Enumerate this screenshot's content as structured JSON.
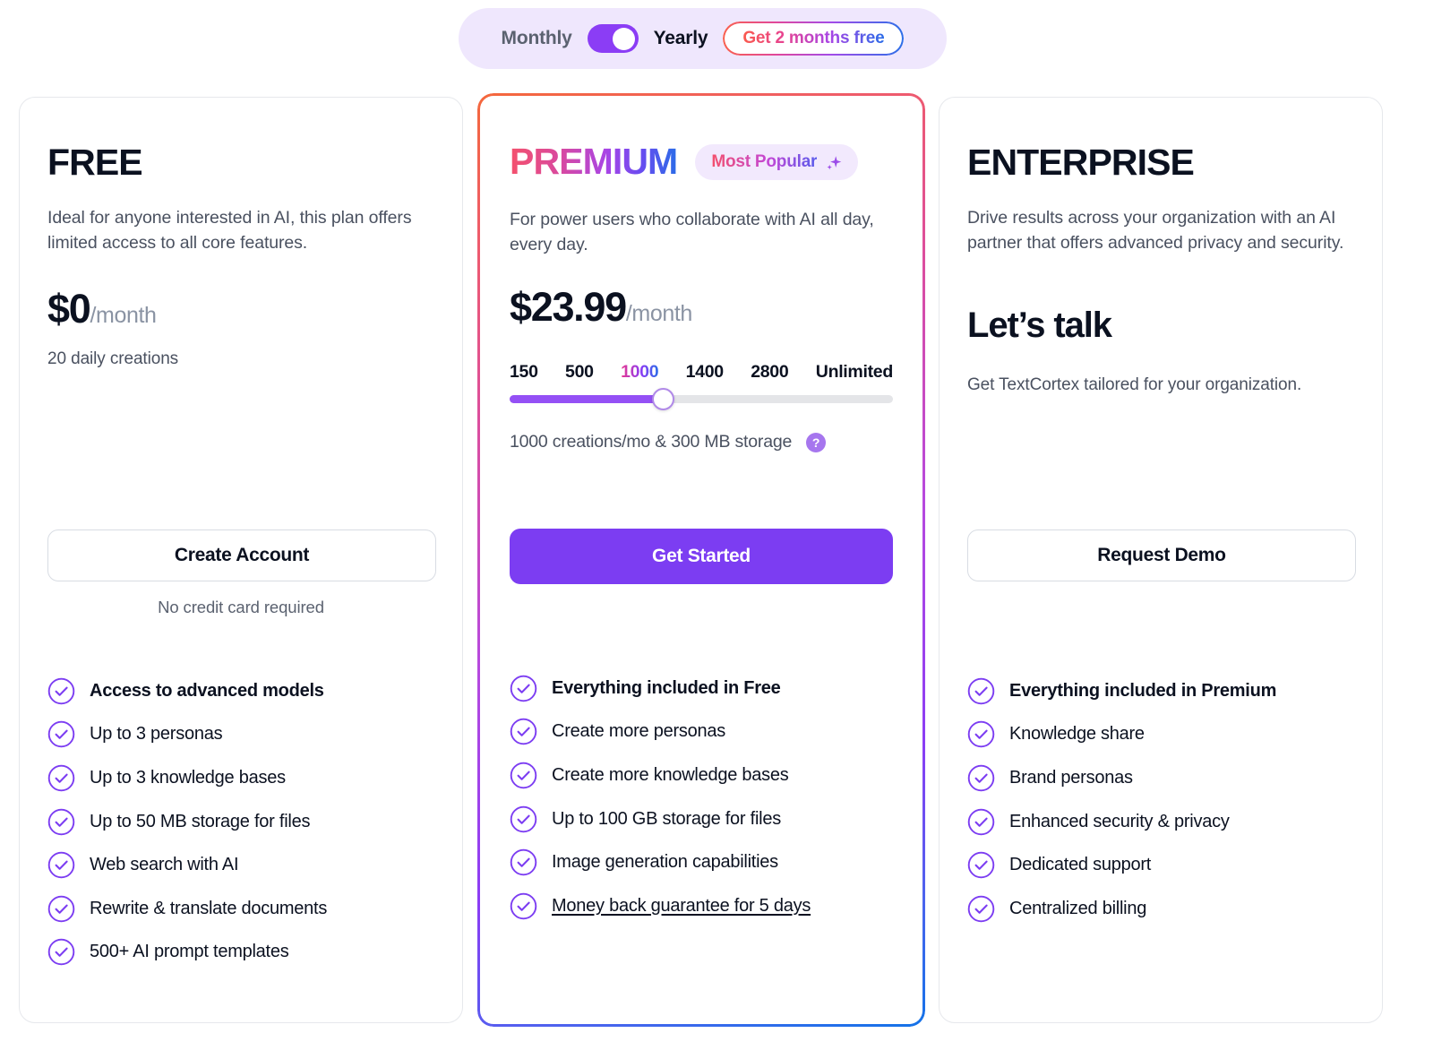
{
  "billing_toggle": {
    "monthly_label": "Monthly",
    "yearly_label": "Yearly",
    "promo_label": "Get 2 months free",
    "selected": "Monthly",
    "switch_state": "on"
  },
  "colors": {
    "accent_purple": "#7C3DF2",
    "toggle_purple": "#8B3DF5",
    "check_purple": "#7C3DF2",
    "badge_bg": "#F2E9FD",
    "toggle_bg": "#EFE7FD",
    "text_dark": "#0B1120",
    "text_muted": "#4A5160",
    "price_period": "#8A93A3",
    "card_border": "#E6E8EC",
    "slider_track": "#E4E5E8",
    "slider_fill": "#9450F5"
  },
  "plans": [
    {
      "name": "FREE",
      "badge": null,
      "description": "Ideal for anyone interested in AI, this plan offers limited access to all core features.",
      "price_amount": "$0",
      "price_period": "/month",
      "price_sub": "20 daily creations",
      "cta_label": "Create Account",
      "cta_style": "outline",
      "cta_note": "No credit card required",
      "features": [
        {
          "label": "Access to advanced models",
          "bold": true,
          "link": false
        },
        {
          "label": "Up to 3 personas",
          "bold": false,
          "link": false
        },
        {
          "label": "Up to 3 knowledge bases",
          "bold": false,
          "link": false
        },
        {
          "label": "Up to 50 MB storage for files",
          "bold": false,
          "link": false
        },
        {
          "label": "Web search with AI",
          "bold": false,
          "link": false
        },
        {
          "label": "Rewrite & translate documents",
          "bold": false,
          "link": false
        },
        {
          "label": "500+ AI prompt templates",
          "bold": false,
          "link": false
        }
      ]
    },
    {
      "name": "PREMIUM",
      "badge": "Most Popular",
      "badge_icon": "sparkles-icon",
      "description": "For power users who collaborate with AI all day, every day.",
      "price_amount": "$23.99",
      "price_period": "/month",
      "slider": {
        "ticks": [
          "150",
          "500",
          "1000",
          "1400",
          "2800",
          "Unlimited"
        ],
        "selected_value": "1000",
        "selected_index": 2,
        "fill_percent": 40,
        "caption": "1000 creations/mo & 300 MB storage",
        "help_icon": "question-mark-icon"
      },
      "cta_label": "Get Started",
      "cta_style": "solid",
      "features": [
        {
          "label": "Everything included in Free",
          "bold": true,
          "link": false
        },
        {
          "label": "Create more personas",
          "bold": false,
          "link": false
        },
        {
          "label": "Create more knowledge bases",
          "bold": false,
          "link": false
        },
        {
          "label": "Up to 100 GB storage for files",
          "bold": false,
          "link": false
        },
        {
          "label": "Image generation capabilities",
          "bold": false,
          "link": false
        },
        {
          "label": "Money back guarantee for 5 days",
          "bold": false,
          "link": true
        }
      ]
    },
    {
      "name": "ENTERPRISE",
      "badge": null,
      "description": "Drive results across your organization with an AI partner that offers advanced privacy and security.",
      "headline": "Let’s talk",
      "price_sub": "Get TextCortex tailored for your organization.",
      "cta_label": "Request Demo",
      "cta_style": "outline",
      "features": [
        {
          "label": "Everything included in Premium",
          "bold": true,
          "link": false
        },
        {
          "label": "Knowledge share",
          "bold": false,
          "link": false
        },
        {
          "label": "Brand personas",
          "bold": false,
          "link": false
        },
        {
          "label": "Enhanced security & privacy",
          "bold": false,
          "link": false
        },
        {
          "label": "Dedicated support",
          "bold": false,
          "link": false
        },
        {
          "label": "Centralized billing",
          "bold": false,
          "link": false
        }
      ]
    }
  ]
}
